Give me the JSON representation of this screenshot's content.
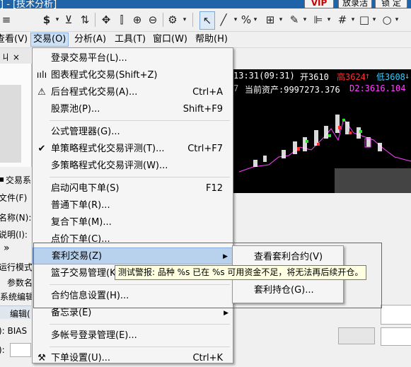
{
  "title": "] - [技术分析]",
  "title_buttons": [
    "VIP",
    "放录活",
    "锁 定"
  ],
  "toolbar": {
    "tools": [
      "dollar-icon",
      "filter-icon",
      "arrow-swap-icon",
      "pan-icon",
      "slider-icon",
      "zoom-in-icon",
      "zoom-out-icon",
      "gear-icon",
      "pointer-icon",
      "line-icon",
      "percent-icon",
      "ruler-icon",
      "pen-icon",
      "align-icon",
      "grid-icon",
      "rect-icon",
      "circle-icon"
    ],
    "labels": {
      "gear_dropdown": "▾",
      "percent": "%"
    }
  },
  "menubar": [
    "查看(V)",
    "交易(O)",
    "分析(A)",
    "工具(T)",
    "窗口(W)",
    "帮助(H)"
  ],
  "left_panel": {
    "pin_label": "ㄐ ×",
    "tab_label": "交易系",
    "file_label": "文件(F)",
    "name_label": "名称(N):",
    "desc_label": "说明(I):",
    "nav_label": "»",
    "run_mode": "运行模式",
    "param_label": "参数名",
    "sys_edit": "系统编辑",
    "edit_tab": "编辑(",
    "field1": "): BIAS",
    "field2": "):"
  },
  "chart": {
    "time": "13:31(09:31)",
    "open_label": "开3610",
    "high_label": "高3624",
    "low_label": "低3608",
    "row2_num": "7",
    "assets_label": "当前资产:9997273.376",
    "d2_label": "D2:3616.104"
  },
  "trade_menu": {
    "items": [
      {
        "label": "登录交易平台(L)...",
        "shortcut": "",
        "icon": ""
      },
      {
        "label": "图表程式化交易(Shift+Z)",
        "shortcut": "",
        "icon": "chart-bars-icon"
      },
      {
        "label": "后台程式化交易(A)...",
        "shortcut": "Ctrl+A",
        "icon": "warning-icon"
      },
      {
        "label": "股票池(P)...",
        "shortcut": "Shift+F9",
        "icon": ""
      },
      {
        "label": "公式管理器(G)...",
        "shortcut": "",
        "icon": ""
      },
      {
        "label": "单策略程式化交易评测(T)...",
        "shortcut": "Ctrl+F7",
        "icon": "check-icon"
      },
      {
        "label": "多策略程式化交易评测(W)...",
        "shortcut": "",
        "icon": ""
      },
      {
        "label": "启动闪电下单(S)",
        "shortcut": "F12",
        "icon": ""
      },
      {
        "label": "普通下单(R)...",
        "shortcut": "",
        "icon": ""
      },
      {
        "label": "复合下单(M)...",
        "shortcut": "",
        "icon": ""
      },
      {
        "label": "点价下单(C)...",
        "shortcut": "",
        "icon": ""
      },
      {
        "label": "套利交易(Z)",
        "shortcut": "",
        "icon": ""
      },
      {
        "label": "篮子交易管理(K)",
        "shortcut": "",
        "icon": ""
      },
      {
        "label": "合约信息设置(H)...",
        "shortcut": "",
        "icon": ""
      },
      {
        "label": "备忘录(E)",
        "shortcut": "",
        "icon": ""
      },
      {
        "label": "多帐号登录管理(E)...",
        "shortcut": "",
        "icon": ""
      },
      {
        "label": "下单设置(U)...",
        "shortcut": "Ctrl+K",
        "icon": "tools-icon"
      }
    ]
  },
  "submenu": {
    "items": [
      "查看套利合约(V)",
      "套利持仓(G)..."
    ]
  },
  "tooltip": "测试警报: 品种 %s 已在 %s 可用资金不足，将无法再后续开仓。"
}
